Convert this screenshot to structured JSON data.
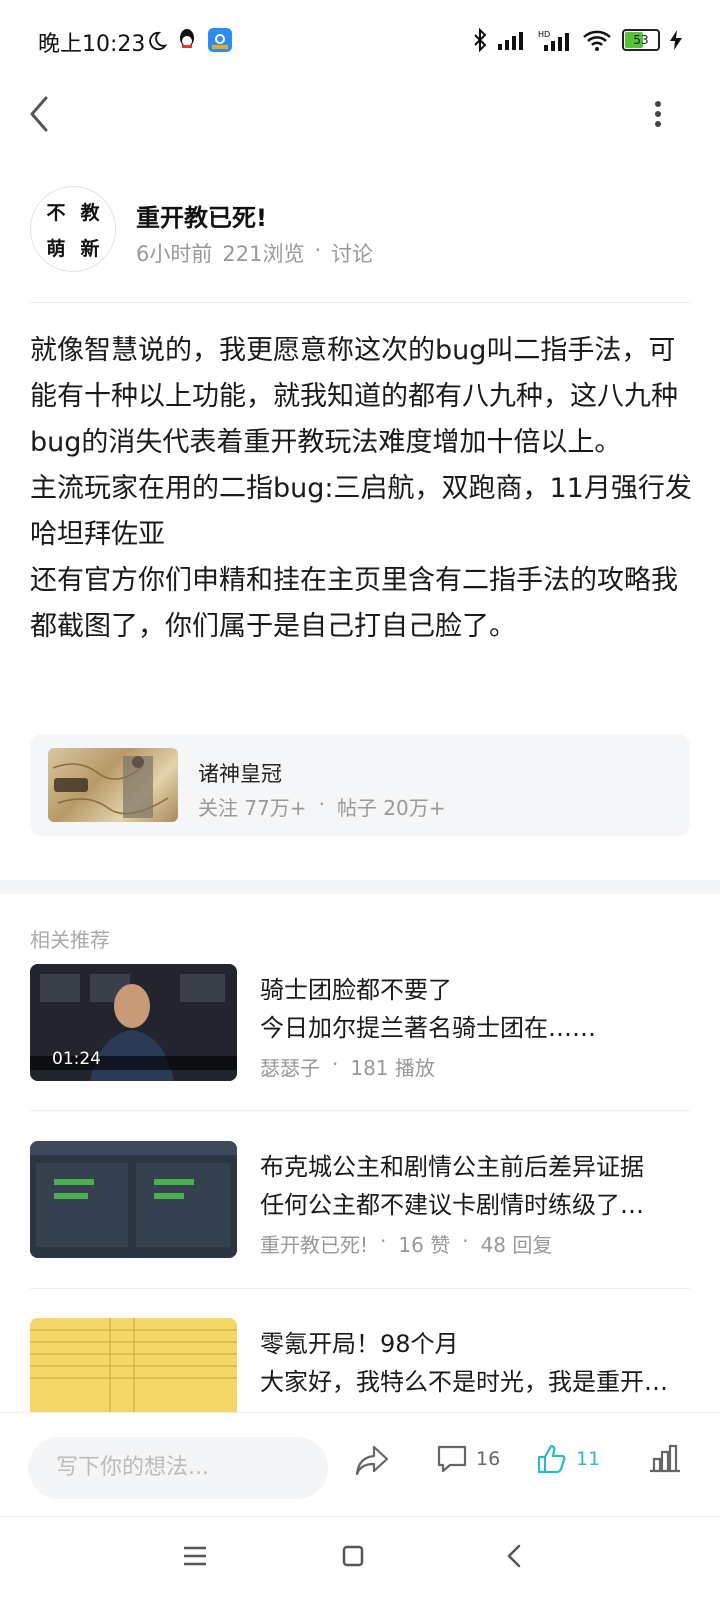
{
  "status_bar": {
    "time": "晚上10:23",
    "battery": "53"
  },
  "author": {
    "avatar_chars": [
      "不",
      "教",
      "萌",
      "新"
    ],
    "name": "重开教已死!",
    "time": "6小时前",
    "views": "221浏览",
    "separator": "·",
    "category": "讨论"
  },
  "post": {
    "paragraphs": [
      "就像智慧说的，我更愿意称这次的bug叫二指手法，可能有十种以上功能，就我知道的都有八九种，这八九种bug的消失代表着重开教玩法难度增加十倍以上。",
      "主流玩家在用的二指bug:三启航，双跑商，11月强行发哈坦拜佐亚",
      "还有官方你们申精和挂在主页里含有二指手法的攻略我都截图了，你们属于是自己打自己脸了。"
    ]
  },
  "forum": {
    "name": "诸神皇冠",
    "follow": "关注 77万+",
    "separator": "·",
    "posts": "帖子 20万+"
  },
  "related": {
    "title": "相关推荐",
    "items": [
      {
        "title": "骑士团脸都不要了",
        "snippet": "今日加尔提兰著名骑士团在……",
        "duration": "01:24",
        "meta": [
          "瑟瑟子",
          "·",
          "181 播放"
        ]
      },
      {
        "title": "布克城公主和剧情公主前后差异证据",
        "snippet": "任何公主都不建议卡剧情时练级了…",
        "meta": [
          "重开教已死!",
          "·",
          "16 赞",
          "·",
          "48 回复"
        ]
      },
      {
        "title": "零氪开局！98个月",
        "snippet": "大家好，我特么不是时光，我是重开…",
        "meta": []
      }
    ]
  },
  "bottom_bar": {
    "input_placeholder": "写下你的想法...",
    "comment_count": "16",
    "like_count": "11"
  },
  "colors": {
    "accent": "#2fb8c8",
    "text": "#1a1a1a",
    "muted": "#999999"
  }
}
